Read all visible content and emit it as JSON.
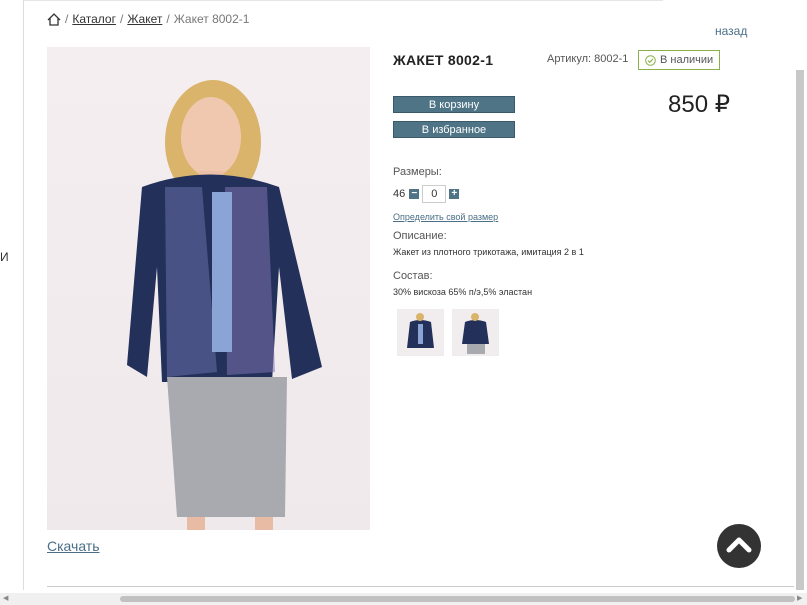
{
  "breadcrumb": {
    "home_icon": "home-icon",
    "separator": "/",
    "catalog": "Каталог",
    "category": "Жакет",
    "current": "Жакет 8002-1"
  },
  "back_link": "назад",
  "left_edge_text": "И",
  "product": {
    "title": "ЖАКЕТ 8002-1",
    "sku": "Артикул: 8002-1",
    "stock": "В наличии",
    "price": "850 ₽",
    "add_to_cart": "В корзину",
    "add_to_favorites": "В избранное",
    "sizes_label": "Размеры:",
    "size": "46",
    "quantity": "0",
    "size_link": "Определить свой размер",
    "description_label": "Описание:",
    "description": "Жакет из плотного трикотажа, имитация 2 в 1",
    "composition_label": "Состав:",
    "composition": "30% вискоза 65% п/э,5% эластан",
    "download": "Скачать"
  },
  "colors": {
    "accent": "#4e7486",
    "link": "#4a6f87",
    "stock_border": "#8ab14a"
  }
}
